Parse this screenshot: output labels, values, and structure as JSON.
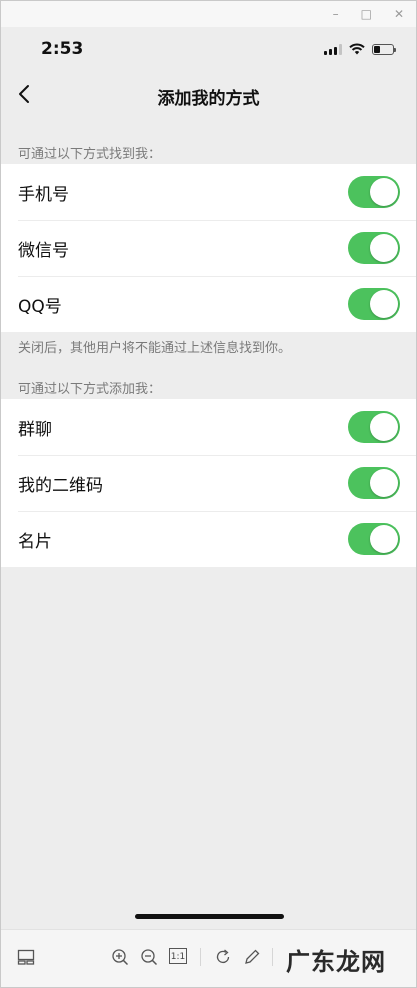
{
  "window": {
    "minimize": "–",
    "maximize": "□",
    "close": "✕"
  },
  "status_bar": {
    "time": "2:53",
    "battery_level": 0.35
  },
  "nav": {
    "title": "添加我的方式",
    "back_icon": "chevron-left-icon"
  },
  "find_section": {
    "header": "可通过以下方式找到我：",
    "items": [
      {
        "label": "手机号",
        "enabled": true
      },
      {
        "label": "微信号",
        "enabled": true
      },
      {
        "label": "QQ号",
        "enabled": true
      }
    ],
    "note": "关闭后，其他用户将不能通过上述信息找到你。"
  },
  "add_section": {
    "header": "可通过以下方式添加我：",
    "items": [
      {
        "label": "群聊",
        "enabled": true
      },
      {
        "label": "我的二维码",
        "enabled": true
      },
      {
        "label": "名片",
        "enabled": true
      }
    ]
  },
  "toolbar": {
    "fit_label": "1:1",
    "watermark": "广东龙网"
  },
  "colors": {
    "toggle_on": "#4cc25d",
    "background": "#ededed"
  }
}
